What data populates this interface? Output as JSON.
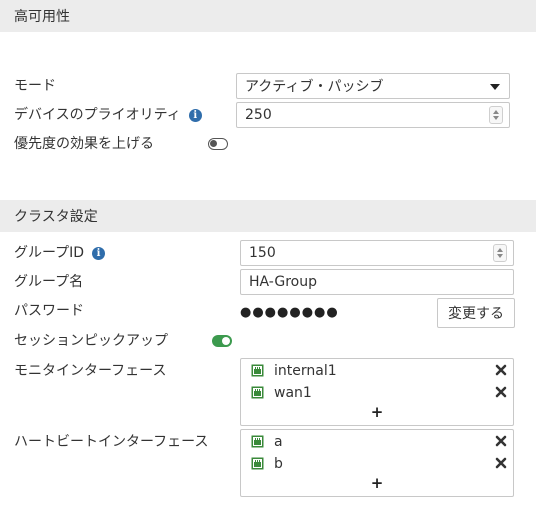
{
  "ha": {
    "title": "高可用性",
    "mode": {
      "label": "モード",
      "value": "アクティブ・パッシブ"
    },
    "device_priority": {
      "label": "デバイスのプライオリティ",
      "value": "250"
    },
    "override": {
      "label": "優先度の効果を上げる",
      "enabled": false
    }
  },
  "cluster": {
    "title": "クラスタ設定",
    "group_id": {
      "label": "グループID",
      "value": "150"
    },
    "group_name": {
      "label": "グループ名",
      "value": "HA-Group"
    },
    "password": {
      "label": "パスワード",
      "masked": "●●●●●●●●",
      "change_label": "変更する"
    },
    "session_pickup": {
      "label": "セッションピックアップ",
      "enabled": true
    },
    "monitor_interfaces": {
      "label": "モニタインターフェース",
      "items": [
        "internal1",
        "wan1"
      ],
      "add_label": "+"
    },
    "heartbeat_interfaces": {
      "label": "ハートビートインターフェース",
      "items": [
        "a",
        "b"
      ],
      "add_label": "+"
    }
  },
  "colors": {
    "toggle_on": "#3c9a4e",
    "info_icon": "#2f6dab",
    "port_icon": "#3a8a3a",
    "section_bg": "#ececec"
  },
  "icons": {
    "info": "info-icon",
    "port": "port-icon",
    "remove": "close-x-icon",
    "toggle": "toggle-switch"
  }
}
